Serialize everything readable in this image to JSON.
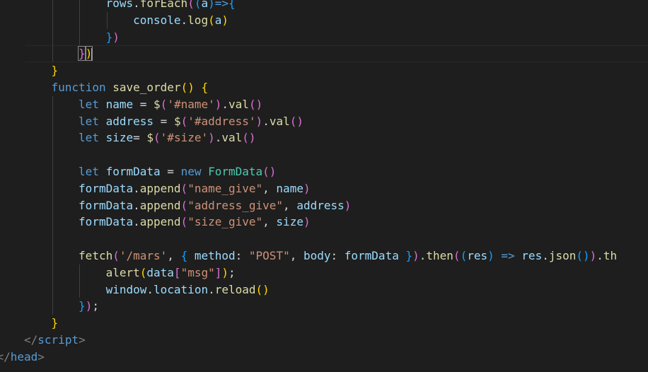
{
  "editor": {
    "background": "#1e1e1e",
    "cursor_line": 3,
    "lines": [
      {
        "indent": 4,
        "guides": [
          2,
          3
        ],
        "tokens": [
          {
            "t": "rows",
            "c": "#9cdcfe"
          },
          {
            "t": ".",
            "c": "#d4d4d4"
          },
          {
            "t": "forEach",
            "c": "#dcdcaa"
          },
          {
            "t": "(",
            "c": "#da70d6"
          },
          {
            "t": "(",
            "c": "#179fff"
          },
          {
            "t": "a",
            "c": "#9cdcfe"
          },
          {
            "t": ")",
            "c": "#179fff"
          },
          {
            "t": "=>",
            "c": "#569cd6"
          },
          {
            "t": "{",
            "c": "#179fff"
          }
        ]
      },
      {
        "indent": 5,
        "guides": [
          2,
          3,
          4
        ],
        "tokens": [
          {
            "t": "console",
            "c": "#9cdcfe"
          },
          {
            "t": ".",
            "c": "#d4d4d4"
          },
          {
            "t": "log",
            "c": "#dcdcaa"
          },
          {
            "t": "(",
            "c": "#ffd700"
          },
          {
            "t": "a",
            "c": "#9cdcfe"
          },
          {
            "t": ")",
            "c": "#ffd700"
          }
        ]
      },
      {
        "indent": 4,
        "guides": [
          2,
          3
        ],
        "tokens": [
          {
            "t": "}",
            "c": "#179fff"
          },
          {
            "t": ")",
            "c": "#da70d6"
          }
        ]
      },
      {
        "indent": 3,
        "guides": [
          2
        ],
        "tokens": [
          {
            "t": "}",
            "c": "#da70d6",
            "match": true
          },
          {
            "t": ")",
            "c": "#ffd700",
            "match": true,
            "caret": true
          }
        ]
      },
      {
        "indent": 2,
        "guides": [],
        "tokens": [
          {
            "t": "}",
            "c": "#ffd700"
          }
        ]
      },
      {
        "indent": 2,
        "guides": [],
        "tokens": [
          {
            "t": "function",
            "c": "#569cd6"
          },
          {
            "t": " ",
            "c": "#d4d4d4"
          },
          {
            "t": "save_order",
            "c": "#dcdcaa"
          },
          {
            "t": "() ",
            "c": "#ffd700"
          },
          {
            "t": "{",
            "c": "#ffd700"
          }
        ]
      },
      {
        "indent": 3,
        "guides": [
          2
        ],
        "tokens": [
          {
            "t": "let",
            "c": "#569cd6"
          },
          {
            "t": " ",
            "c": "#d4d4d4"
          },
          {
            "t": "name",
            "c": "#9cdcfe"
          },
          {
            "t": " = ",
            "c": "#d4d4d4"
          },
          {
            "t": "$",
            "c": "#dcdcaa"
          },
          {
            "t": "(",
            "c": "#da70d6"
          },
          {
            "t": "'#name'",
            "c": "#ce9178"
          },
          {
            "t": ")",
            "c": "#da70d6"
          },
          {
            "t": ".",
            "c": "#d4d4d4"
          },
          {
            "t": "val",
            "c": "#dcdcaa"
          },
          {
            "t": "()",
            "c": "#da70d6"
          }
        ]
      },
      {
        "indent": 3,
        "guides": [
          2
        ],
        "tokens": [
          {
            "t": "let",
            "c": "#569cd6"
          },
          {
            "t": " ",
            "c": "#d4d4d4"
          },
          {
            "t": "address",
            "c": "#9cdcfe"
          },
          {
            "t": " = ",
            "c": "#d4d4d4"
          },
          {
            "t": "$",
            "c": "#dcdcaa"
          },
          {
            "t": "(",
            "c": "#da70d6"
          },
          {
            "t": "'#address'",
            "c": "#ce9178"
          },
          {
            "t": ")",
            "c": "#da70d6"
          },
          {
            "t": ".",
            "c": "#d4d4d4"
          },
          {
            "t": "val",
            "c": "#dcdcaa"
          },
          {
            "t": "()",
            "c": "#da70d6"
          }
        ]
      },
      {
        "indent": 3,
        "guides": [
          2
        ],
        "tokens": [
          {
            "t": "let",
            "c": "#569cd6"
          },
          {
            "t": " ",
            "c": "#d4d4d4"
          },
          {
            "t": "size",
            "c": "#9cdcfe"
          },
          {
            "t": "= ",
            "c": "#d4d4d4"
          },
          {
            "t": "$",
            "c": "#dcdcaa"
          },
          {
            "t": "(",
            "c": "#da70d6"
          },
          {
            "t": "'#size'",
            "c": "#ce9178"
          },
          {
            "t": ")",
            "c": "#da70d6"
          },
          {
            "t": ".",
            "c": "#d4d4d4"
          },
          {
            "t": "val",
            "c": "#dcdcaa"
          },
          {
            "t": "()",
            "c": "#da70d6"
          }
        ]
      },
      {
        "indent": 0,
        "guides": [
          2
        ],
        "tokens": []
      },
      {
        "indent": 3,
        "guides": [
          2
        ],
        "tokens": [
          {
            "t": "let",
            "c": "#569cd6"
          },
          {
            "t": " ",
            "c": "#d4d4d4"
          },
          {
            "t": "formData",
            "c": "#9cdcfe"
          },
          {
            "t": " = ",
            "c": "#d4d4d4"
          },
          {
            "t": "new",
            "c": "#569cd6"
          },
          {
            "t": " ",
            "c": "#d4d4d4"
          },
          {
            "t": "FormData",
            "c": "#4ec9b0"
          },
          {
            "t": "()",
            "c": "#da70d6"
          }
        ]
      },
      {
        "indent": 3,
        "guides": [
          2
        ],
        "tokens": [
          {
            "t": "formData",
            "c": "#9cdcfe"
          },
          {
            "t": ".",
            "c": "#d4d4d4"
          },
          {
            "t": "append",
            "c": "#dcdcaa"
          },
          {
            "t": "(",
            "c": "#da70d6"
          },
          {
            "t": "\"name_give\"",
            "c": "#ce9178"
          },
          {
            "t": ", ",
            "c": "#d4d4d4"
          },
          {
            "t": "name",
            "c": "#9cdcfe"
          },
          {
            "t": ")",
            "c": "#da70d6"
          }
        ]
      },
      {
        "indent": 3,
        "guides": [
          2
        ],
        "tokens": [
          {
            "t": "formData",
            "c": "#9cdcfe"
          },
          {
            "t": ".",
            "c": "#d4d4d4"
          },
          {
            "t": "append",
            "c": "#dcdcaa"
          },
          {
            "t": "(",
            "c": "#da70d6"
          },
          {
            "t": "\"address_give\"",
            "c": "#ce9178"
          },
          {
            "t": ", ",
            "c": "#d4d4d4"
          },
          {
            "t": "address",
            "c": "#9cdcfe"
          },
          {
            "t": ")",
            "c": "#da70d6"
          }
        ]
      },
      {
        "indent": 3,
        "guides": [
          2
        ],
        "tokens": [
          {
            "t": "formData",
            "c": "#9cdcfe"
          },
          {
            "t": ".",
            "c": "#d4d4d4"
          },
          {
            "t": "append",
            "c": "#dcdcaa"
          },
          {
            "t": "(",
            "c": "#da70d6"
          },
          {
            "t": "\"size_give\"",
            "c": "#ce9178"
          },
          {
            "t": ", ",
            "c": "#d4d4d4"
          },
          {
            "t": "size",
            "c": "#9cdcfe"
          },
          {
            "t": ")",
            "c": "#da70d6"
          }
        ]
      },
      {
        "indent": 0,
        "guides": [
          2
        ],
        "tokens": []
      },
      {
        "indent": 3,
        "guides": [
          2
        ],
        "tokens": [
          {
            "t": "fetch",
            "c": "#dcdcaa"
          },
          {
            "t": "(",
            "c": "#da70d6"
          },
          {
            "t": "'/mars'",
            "c": "#ce9178"
          },
          {
            "t": ", ",
            "c": "#d4d4d4"
          },
          {
            "t": "{",
            "c": "#179fff"
          },
          {
            "t": " ",
            "c": "#d4d4d4"
          },
          {
            "t": "method",
            "c": "#9cdcfe"
          },
          {
            "t": ": ",
            "c": "#d4d4d4"
          },
          {
            "t": "\"POST\"",
            "c": "#ce9178"
          },
          {
            "t": ", ",
            "c": "#d4d4d4"
          },
          {
            "t": "body",
            "c": "#9cdcfe"
          },
          {
            "t": ": ",
            "c": "#d4d4d4"
          },
          {
            "t": "formData",
            "c": "#9cdcfe"
          },
          {
            "t": " ",
            "c": "#d4d4d4"
          },
          {
            "t": "}",
            "c": "#179fff"
          },
          {
            "t": ")",
            "c": "#da70d6"
          },
          {
            "t": ".",
            "c": "#d4d4d4"
          },
          {
            "t": "then",
            "c": "#dcdcaa"
          },
          {
            "t": "(",
            "c": "#da70d6"
          },
          {
            "t": "(",
            "c": "#179fff"
          },
          {
            "t": "res",
            "c": "#9cdcfe"
          },
          {
            "t": ")",
            "c": "#179fff"
          },
          {
            "t": " ",
            "c": "#d4d4d4"
          },
          {
            "t": "=>",
            "c": "#569cd6"
          },
          {
            "t": " ",
            "c": "#d4d4d4"
          },
          {
            "t": "res",
            "c": "#9cdcfe"
          },
          {
            "t": ".",
            "c": "#d4d4d4"
          },
          {
            "t": "json",
            "c": "#dcdcaa"
          },
          {
            "t": "()",
            "c": "#179fff"
          },
          {
            "t": ")",
            "c": "#da70d6"
          },
          {
            "t": ".",
            "c": "#d4d4d4"
          },
          {
            "t": "th",
            "c": "#dcdcaa"
          }
        ]
      },
      {
        "indent": 4,
        "guides": [
          2,
          3
        ],
        "tokens": [
          {
            "t": "alert",
            "c": "#dcdcaa"
          },
          {
            "t": "(",
            "c": "#ffd700"
          },
          {
            "t": "data",
            "c": "#9cdcfe"
          },
          {
            "t": "[",
            "c": "#da70d6"
          },
          {
            "t": "\"msg\"",
            "c": "#ce9178"
          },
          {
            "t": "]",
            "c": "#da70d6"
          },
          {
            "t": ")",
            "c": "#ffd700"
          },
          {
            "t": ";",
            "c": "#d4d4d4"
          }
        ]
      },
      {
        "indent": 4,
        "guides": [
          2,
          3
        ],
        "tokens": [
          {
            "t": "window",
            "c": "#9cdcfe"
          },
          {
            "t": ".",
            "c": "#d4d4d4"
          },
          {
            "t": "location",
            "c": "#9cdcfe"
          },
          {
            "t": ".",
            "c": "#d4d4d4"
          },
          {
            "t": "reload",
            "c": "#dcdcaa"
          },
          {
            "t": "()",
            "c": "#ffd700"
          }
        ]
      },
      {
        "indent": 3,
        "guides": [
          2
        ],
        "tokens": [
          {
            "t": "}",
            "c": "#179fff"
          },
          {
            "t": ")",
            "c": "#da70d6"
          },
          {
            "t": ";",
            "c": "#d4d4d4"
          }
        ]
      },
      {
        "indent": 2,
        "guides": [],
        "tokens": [
          {
            "t": "}",
            "c": "#ffd700"
          }
        ]
      },
      {
        "indent": 1,
        "guides": [],
        "tokens": [
          {
            "t": "</",
            "c": "#808080"
          },
          {
            "t": "script",
            "c": "#569cd6"
          },
          {
            "t": ">",
            "c": "#808080"
          }
        ]
      },
      {
        "indent": 0,
        "guides": [],
        "tokens": [
          {
            "t": "</",
            "c": "#808080"
          },
          {
            "t": "head",
            "c": "#569cd6"
          },
          {
            "t": ">",
            "c": "#808080"
          }
        ]
      }
    ]
  }
}
